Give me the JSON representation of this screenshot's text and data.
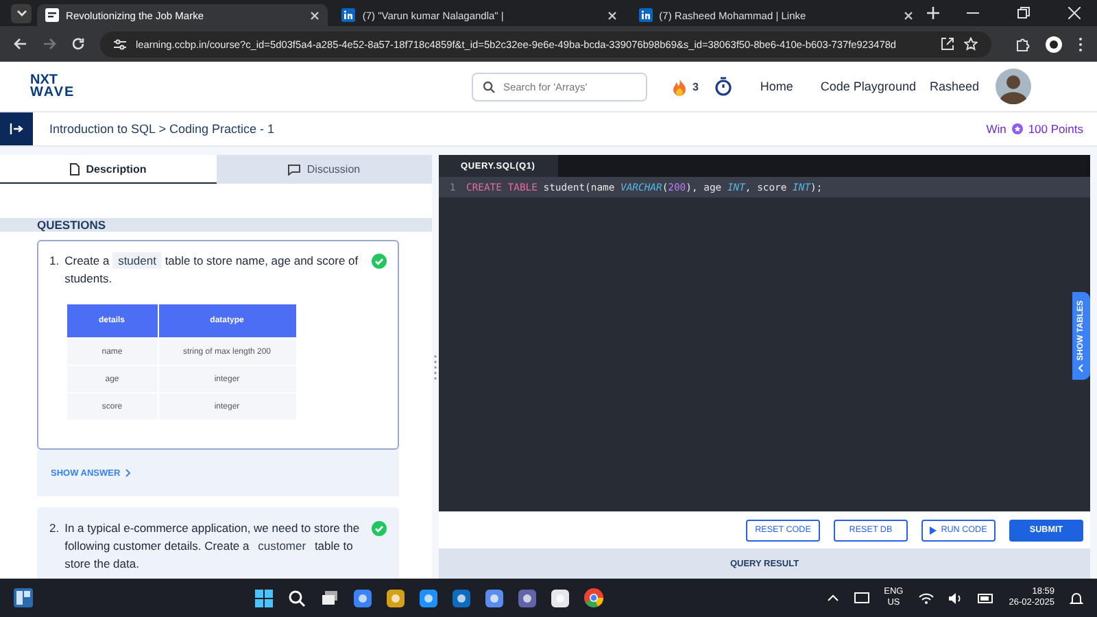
{
  "browser": {
    "tabs": [
      {
        "title": "Revolutionizing the Job Marke",
        "selected": true,
        "kind": "site"
      },
      {
        "title": "(7) \"Varun kumar Nalagandla\" |",
        "selected": false,
        "kind": "linkedin"
      },
      {
        "title": "(7) Rasheed Mohammad | Linke",
        "selected": false,
        "kind": "linkedin"
      }
    ],
    "url": "learning.ccbp.in/course?c_id=5d03f5a4-a285-4e52-8a57-18f718c4859f&t_id=5b2c32ee-9e6e-49ba-bcda-339076b98b69&s_id=38063f50-8be6-410e-b603-737fe923478d"
  },
  "header": {
    "logo_top": "NXT",
    "logo_bottom": "WAVE",
    "search": {
      "placeholder": "Search for 'Arrays'"
    },
    "streak": "3",
    "nav": [
      "Home",
      "Code Playground"
    ],
    "user": "Rasheed"
  },
  "breadcrumb": "Introduction to SQL > Coding Practice - 1",
  "reward": {
    "prefix": "Win",
    "points": "100 Points"
  },
  "left_tabs": [
    {
      "label": "Description",
      "selected": true,
      "kind": "page"
    },
    {
      "label": "Discussion",
      "selected": false,
      "kind": "chat"
    }
  ],
  "questions_heading": "QUESTIONS",
  "questions": [
    {
      "number": "1.",
      "completed": true,
      "selected": true,
      "parts": [
        {
          "kind": "text",
          "text": "Create a"
        },
        {
          "kind": "code",
          "text": "student"
        },
        {
          "kind": "text",
          "text": "table to store name, age and score of students."
        }
      ],
      "table": {
        "columns": [
          "details",
          "datatype"
        ],
        "rows": [
          [
            "name",
            "string of max length 200"
          ],
          [
            "age",
            "integer"
          ],
          [
            "score",
            "integer"
          ]
        ]
      },
      "show_answer": "SHOW ANSWER"
    },
    {
      "number": "2.",
      "completed": true,
      "selected": false,
      "parts": [
        {
          "kind": "text",
          "text": "In a typical e-commerce application, we need to store the following customer details. Create a"
        },
        {
          "kind": "code",
          "text": "customer"
        },
        {
          "kind": "text",
          "text": "table to store the data."
        }
      ]
    }
  ],
  "editor": {
    "tab": "QUERY.SQL(Q1)",
    "lines": [
      {
        "number": "1",
        "tokens": [
          {
            "kind": "keyword",
            "text": "CREATE TABLE"
          },
          {
            "kind": "plain",
            "text": " student(name "
          },
          {
            "kind": "type",
            "text": "VARCHAR"
          },
          {
            "kind": "plain",
            "text": "("
          },
          {
            "kind": "number",
            "text": "200"
          },
          {
            "kind": "plain",
            "text": "), age "
          },
          {
            "kind": "type",
            "text": "INT"
          },
          {
            "kind": "plain",
            "text": ", score "
          },
          {
            "kind": "type",
            "text": "INT"
          },
          {
            "kind": "plain",
            "text": ");"
          }
        ]
      }
    ],
    "show_tables": "SHOW TABLES"
  },
  "buttons": [
    {
      "label": "RESET CODE",
      "kind": "outline"
    },
    {
      "label": "RESET DB",
      "kind": "outline"
    },
    {
      "label": "RUN CODE",
      "kind": "run"
    },
    {
      "label": "SUBMIT",
      "kind": "primary"
    }
  ],
  "query_result": "QUERY RESULT",
  "taskbar": {
    "language": "ENG",
    "region": "US",
    "time": "18:59",
    "date": "26-02-2025"
  }
}
